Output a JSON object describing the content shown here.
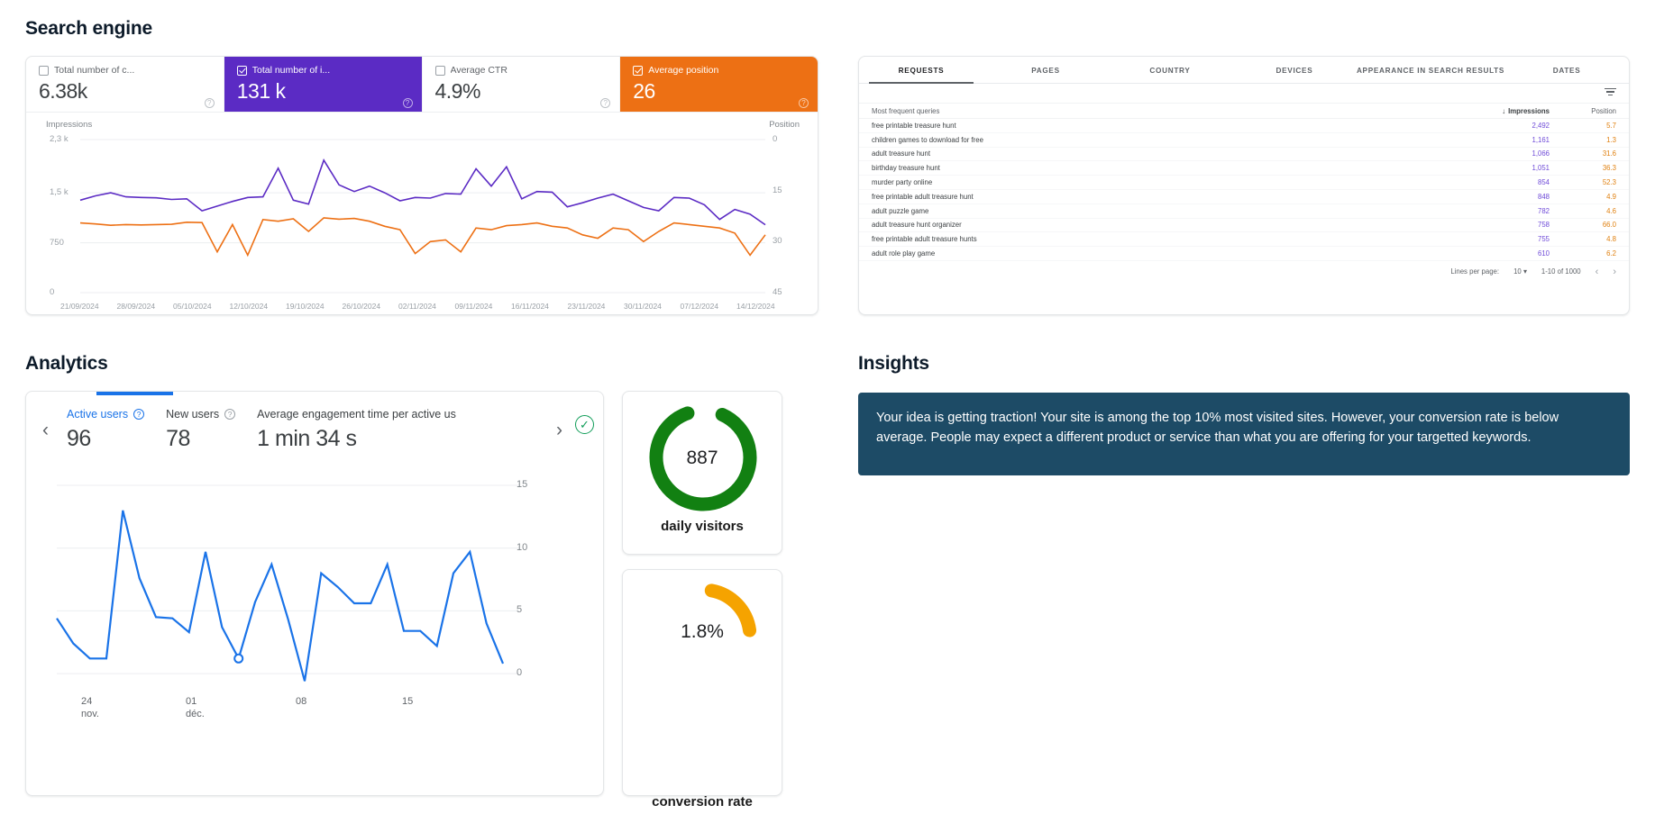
{
  "sections": {
    "search_engine": "Search engine",
    "analytics": "Analytics",
    "insights": "Insights"
  },
  "search_engine": {
    "metrics": [
      {
        "label": "Total number of c...",
        "value": "6.38k",
        "checked": false,
        "state": "plain"
      },
      {
        "label": "Total number of i...",
        "value": "131 k",
        "checked": true,
        "state": "purple"
      },
      {
        "label": "Average CTR",
        "value": "4.9%",
        "checked": false,
        "state": "plain"
      },
      {
        "label": "Average position",
        "value": "26",
        "checked": true,
        "state": "orange"
      }
    ],
    "help_glyph": "?",
    "chart": {
      "left_axis_title": "Impressions",
      "right_axis_title": "Position",
      "left_ticks": [
        "2,3 k",
        "1,5 k",
        "750",
        "0"
      ],
      "right_ticks": [
        "0",
        "15",
        "30",
        "45"
      ],
      "x_ticks": [
        "21/09/2024",
        "28/09/2024",
        "05/10/2024",
        "12/10/2024",
        "19/10/2024",
        "26/10/2024",
        "02/11/2024",
        "09/11/2024",
        "16/11/2024",
        "23/11/2024",
        "30/11/2024",
        "07/12/2024",
        "14/12/2024"
      ]
    }
  },
  "chart_data": [
    {
      "type": "line",
      "title": "Search engine impressions and position",
      "xlabel": "",
      "ylabel": "Impressions",
      "y2label": "Position",
      "ylim": [
        0,
        2300
      ],
      "y2lim": [
        45,
        0
      ],
      "yticks": [
        0,
        750,
        1500,
        2300
      ],
      "y2ticks": [
        0,
        15,
        30,
        45
      ],
      "grid": true,
      "legend": "none",
      "x": [
        "21/09/2024",
        "28/09/2024",
        "05/10/2024",
        "12/10/2024",
        "19/10/2024",
        "26/10/2024",
        "02/11/2024",
        "09/11/2024",
        "16/11/2024",
        "23/11/2024",
        "30/11/2024",
        "07/12/2024",
        "14/12/2024"
      ],
      "series": [
        {
          "name": "Impressions",
          "color": "#5b2bc4",
          "axis": "left",
          "values": [
            1390,
            1455,
            1500,
            1440,
            1430,
            1425,
            1400,
            1410,
            1230,
            1300,
            1370,
            1430,
            1440,
            1870,
            1390,
            1330,
            1990,
            1620,
            1520,
            1600,
            1500,
            1380,
            1430,
            1420,
            1490,
            1480,
            1860,
            1600,
            1890,
            1410,
            1520,
            1510,
            1290,
            1350,
            1420,
            1480,
            1380,
            1280,
            1230,
            1430,
            1420,
            1320,
            1100,
            1250,
            1180,
            1020
          ]
        },
        {
          "name": "Position",
          "color": "#ed7014",
          "axis": "right",
          "values": [
            24.5,
            24.8,
            25.2,
            25.0,
            25.1,
            25.0,
            24.9,
            24.3,
            24.4,
            33.0,
            25.0,
            34.0,
            23.5,
            24.0,
            23.3,
            27.0,
            23.0,
            23.4,
            23.2,
            24.0,
            25.5,
            26.5,
            33.5,
            30.0,
            29.5,
            33.0,
            26.0,
            26.5,
            25.3,
            25.0,
            24.5,
            25.5,
            26.0,
            28.0,
            29.0,
            26.0,
            26.5,
            30.0,
            27.0,
            24.5,
            25.0,
            25.5,
            26.0,
            27.5,
            34.0,
            28.0
          ]
        }
      ]
    },
    {
      "type": "line",
      "title": "Active users over time",
      "xlabel": "",
      "ylabel": "",
      "ylim": [
        -1,
        15
      ],
      "yticks": [
        0,
        5,
        10,
        15
      ],
      "grid": true,
      "legend": "none",
      "x_tick_labels": [
        "24 nov.",
        "01 déc.",
        "08",
        "15"
      ],
      "series": [
        {
          "name": "Active users",
          "color": "#1a73e8",
          "values": [
            4.4,
            2.4,
            1.2,
            1.2,
            13.0,
            7.6,
            4.5,
            4.4,
            3.3,
            9.7,
            3.7,
            1.2,
            5.7,
            8.7,
            4.3,
            -0.6,
            8.0,
            6.9,
            5.6,
            5.6,
            8.7,
            3.4,
            3.4,
            2.2,
            8.0,
            9.7,
            4.0,
            0.8
          ]
        }
      ],
      "annotation_point": {
        "x_index": 11,
        "y": 1.2
      }
    },
    {
      "type": "pie",
      "title": "daily visitors",
      "value": 887,
      "display_value": "887",
      "color": "#128012",
      "fraction": 0.88
    },
    {
      "type": "pie",
      "title": "conversion rate",
      "value": 1.8,
      "display_value": "1.8%",
      "color": "#f5a300",
      "fraction": 0.2
    }
  ],
  "requests_panel": {
    "tabs": [
      {
        "label": "REQUESTS",
        "active": true
      },
      {
        "label": "PAGES",
        "active": false
      },
      {
        "label": "COUNTRY",
        "active": false
      },
      {
        "label": "DEVICES",
        "active": false
      },
      {
        "label": "APPEARANCE IN SEARCH RESULTS",
        "active": false
      },
      {
        "label": "DATES",
        "active": false
      }
    ],
    "columns": {
      "query": "Most frequent queries",
      "impressions": "Impressions",
      "position": "Position",
      "sort_arrow": "↓"
    },
    "rows": [
      {
        "query": "free printable treasure hunt",
        "impressions": "2,492",
        "position": "5.7"
      },
      {
        "query": "children games to download for free",
        "impressions": "1,161",
        "position": "1.3"
      },
      {
        "query": "adult treasure hunt",
        "impressions": "1,066",
        "position": "31.6"
      },
      {
        "query": "birthday treasure hunt",
        "impressions": "1,051",
        "position": "36.3"
      },
      {
        "query": "murder party online",
        "impressions": "854",
        "position": "52.3"
      },
      {
        "query": "free printable adult treasure hunt",
        "impressions": "848",
        "position": "4.9"
      },
      {
        "query": "adult puzzle game",
        "impressions": "782",
        "position": "4.6"
      },
      {
        "query": "adult treasure hunt organizer",
        "impressions": "758",
        "position": "66.0"
      },
      {
        "query": "free printable adult treasure hunts",
        "impressions": "755",
        "position": "4.8"
      },
      {
        "query": "adult role play game",
        "impressions": "610",
        "position": "6.2"
      }
    ],
    "pagination": {
      "lines_per_page_label": "Lines per page:",
      "lines_per_page_value": "10",
      "range": "1-10 of 1000",
      "prev": "‹",
      "next": "›"
    }
  },
  "analytics_panel": {
    "prev_arrow": "‹",
    "next_arrow": "›",
    "ok_glyph": "✓",
    "kpis": [
      {
        "label": "Active users",
        "value": "96",
        "active": true,
        "help": "?"
      },
      {
        "label": "New users",
        "value": "78",
        "active": false,
        "help": "?"
      },
      {
        "label": "Average engagement time per active us",
        "value": "1 min 34 s",
        "active": false,
        "help": ""
      }
    ],
    "chart": {
      "y_ticks": [
        "15",
        "10",
        "5",
        "0"
      ],
      "x_ticks": [
        {
          "top": "24",
          "bottom": "nov."
        },
        {
          "top": "01",
          "bottom": "déc."
        },
        {
          "top": "08",
          "bottom": ""
        },
        {
          "top": "15",
          "bottom": ""
        }
      ]
    }
  },
  "tiles": {
    "donut": {
      "value": "887",
      "caption": "daily visitors",
      "color": "#128012"
    },
    "gauge": {
      "value": "1.8%",
      "caption": "conversion rate",
      "color": "#f5a300"
    }
  },
  "insights": {
    "text": "Your idea is getting traction! Your site is among the top 10% most visited sites. However, your conversion rate is below average. People may expect a different product or service than what you are offering for your targetted keywords.",
    "background": "#1d4b66"
  }
}
